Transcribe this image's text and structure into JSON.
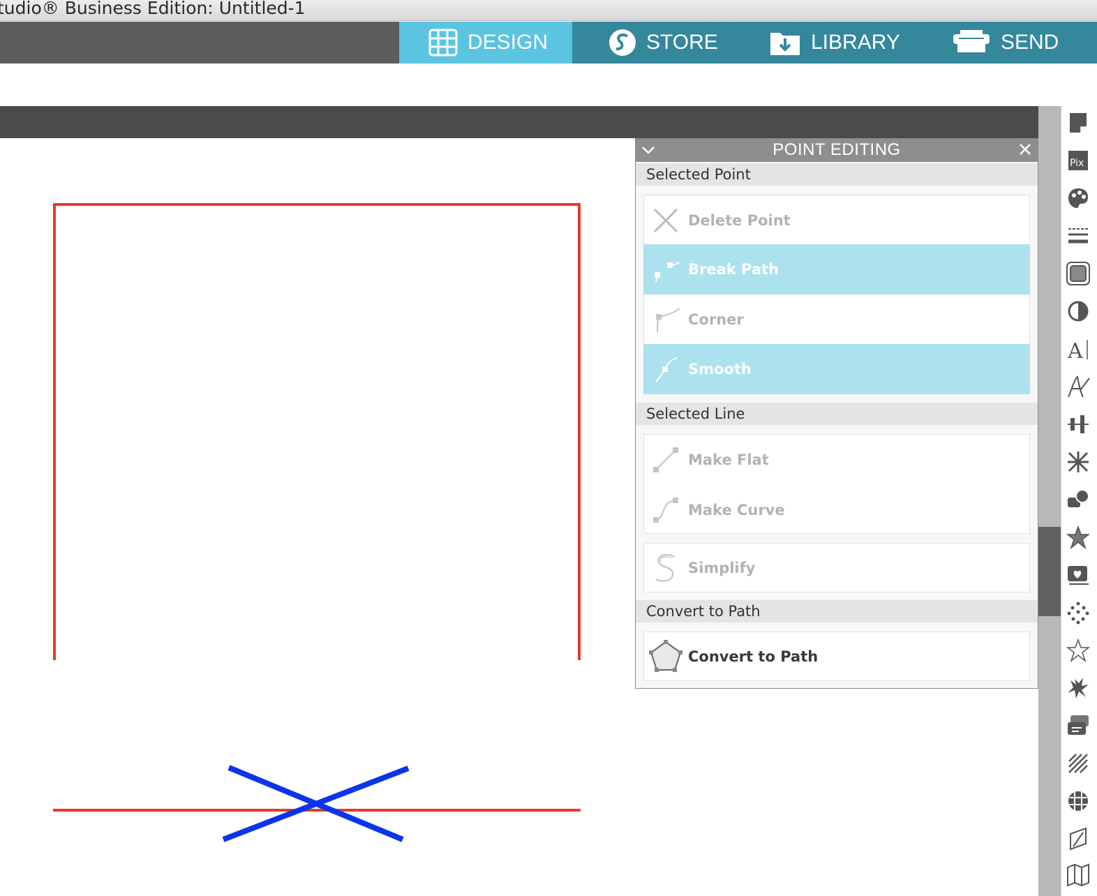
{
  "window": {
    "title": "tudio® Business Edition: Untitled-1"
  },
  "nav": {
    "tabs": [
      {
        "label": "DESIGN",
        "icon": "grid-icon",
        "active": true
      },
      {
        "label": "STORE",
        "icon": "store-s-icon",
        "active": false
      },
      {
        "label": "LIBRARY",
        "icon": "folder-download-icon",
        "active": false
      },
      {
        "label": "SEND",
        "icon": "cutter-icon",
        "active": false
      }
    ]
  },
  "panel": {
    "title": "POINT EDITING",
    "sections": {
      "selected_point": "Selected Point",
      "selected_line": "Selected Line",
      "convert": "Convert to Path"
    },
    "buttons": {
      "delete_point": "Delete Point",
      "break_path": "Break Path",
      "corner": "Corner",
      "smooth": "Smooth",
      "make_flat": "Make Flat",
      "make_curve": "Make Curve",
      "simplify": "Simplify",
      "convert_to_path": "Convert to Path"
    }
  },
  "right_panel_icons": [
    "page-setup-icon",
    "pixscan-icon",
    "fill-color-icon",
    "line-style-icon",
    "trace-icon",
    "contrast-icon",
    "text-style-icon",
    "sketch-text-icon",
    "align-icon",
    "replicate-icon",
    "modify-icon",
    "favorites-star-icon",
    "library-heart-icon",
    "rhinestone-icon",
    "star-outline-icon",
    "puzzle-icon",
    "layers-icon",
    "hatch-icon",
    "warp-icon",
    "emboss-icon",
    "fold-icon"
  ],
  "colors": {
    "accent": "#5bc4e1",
    "nav_bg": "#35879c",
    "highlight": "#ace2ee",
    "shape_red": "#e8392b",
    "shape_blue": "#0a35e8"
  }
}
